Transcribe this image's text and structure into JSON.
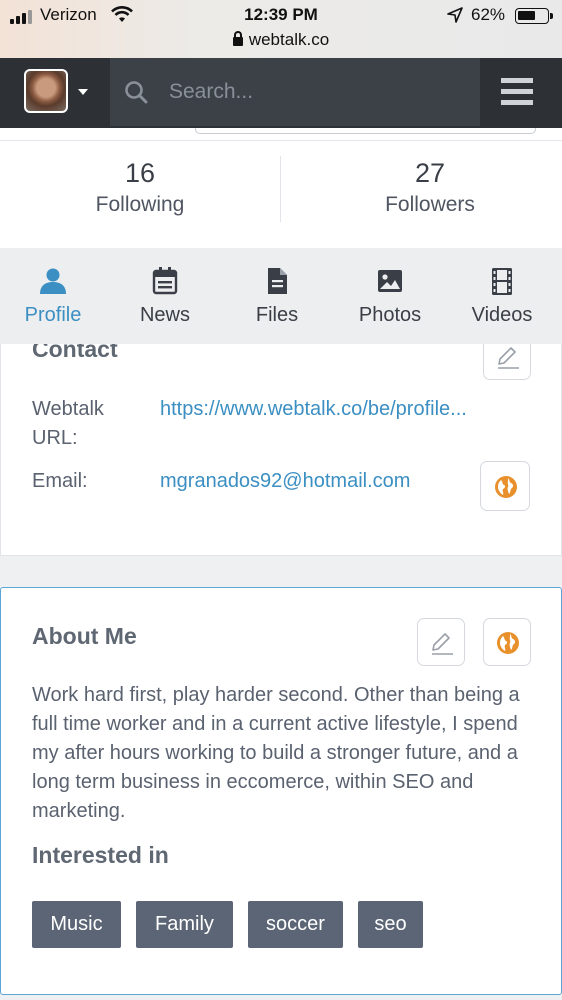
{
  "status_bar": {
    "carrier": "Verizon",
    "time": "12:39 PM",
    "battery": "62%",
    "battery_level": 0.62,
    "url": "webtalk.co"
  },
  "header": {
    "search_placeholder": "Search..."
  },
  "stats": [
    {
      "count": "16",
      "label": "Following"
    },
    {
      "count": "27",
      "label": "Followers"
    }
  ],
  "tabs": [
    {
      "label": "Profile",
      "icon": "person-icon",
      "active": true
    },
    {
      "label": "News",
      "icon": "calendar-icon",
      "active": false
    },
    {
      "label": "Files",
      "icon": "file-icon",
      "active": false
    },
    {
      "label": "Photos",
      "icon": "image-icon",
      "active": false
    },
    {
      "label": "Videos",
      "icon": "film-icon",
      "active": false
    }
  ],
  "contact": {
    "title": "Contact",
    "url_label_line1": "Webtalk",
    "url_label_line2": "URL:",
    "url_value": "https://www.webtalk.co/be/profile...",
    "email_label": "Email:",
    "email_value": "mgranados92@hotmail.com"
  },
  "about": {
    "title": "About Me",
    "text": "Work hard first, play harder second. Other than being a full time worker and in a current active lifestyle, I spend my after hours working to build a stronger future, and a long term business in eccomerce, within SEO and marketing.",
    "interests_title": "Interested in",
    "interests": [
      "Music",
      "Family",
      "soccer",
      "seo"
    ]
  },
  "colors": {
    "accent": "#3b8fc2",
    "globe": "#e8912c",
    "header_bg": "#2d3136",
    "tag_bg": "#5b6575"
  }
}
